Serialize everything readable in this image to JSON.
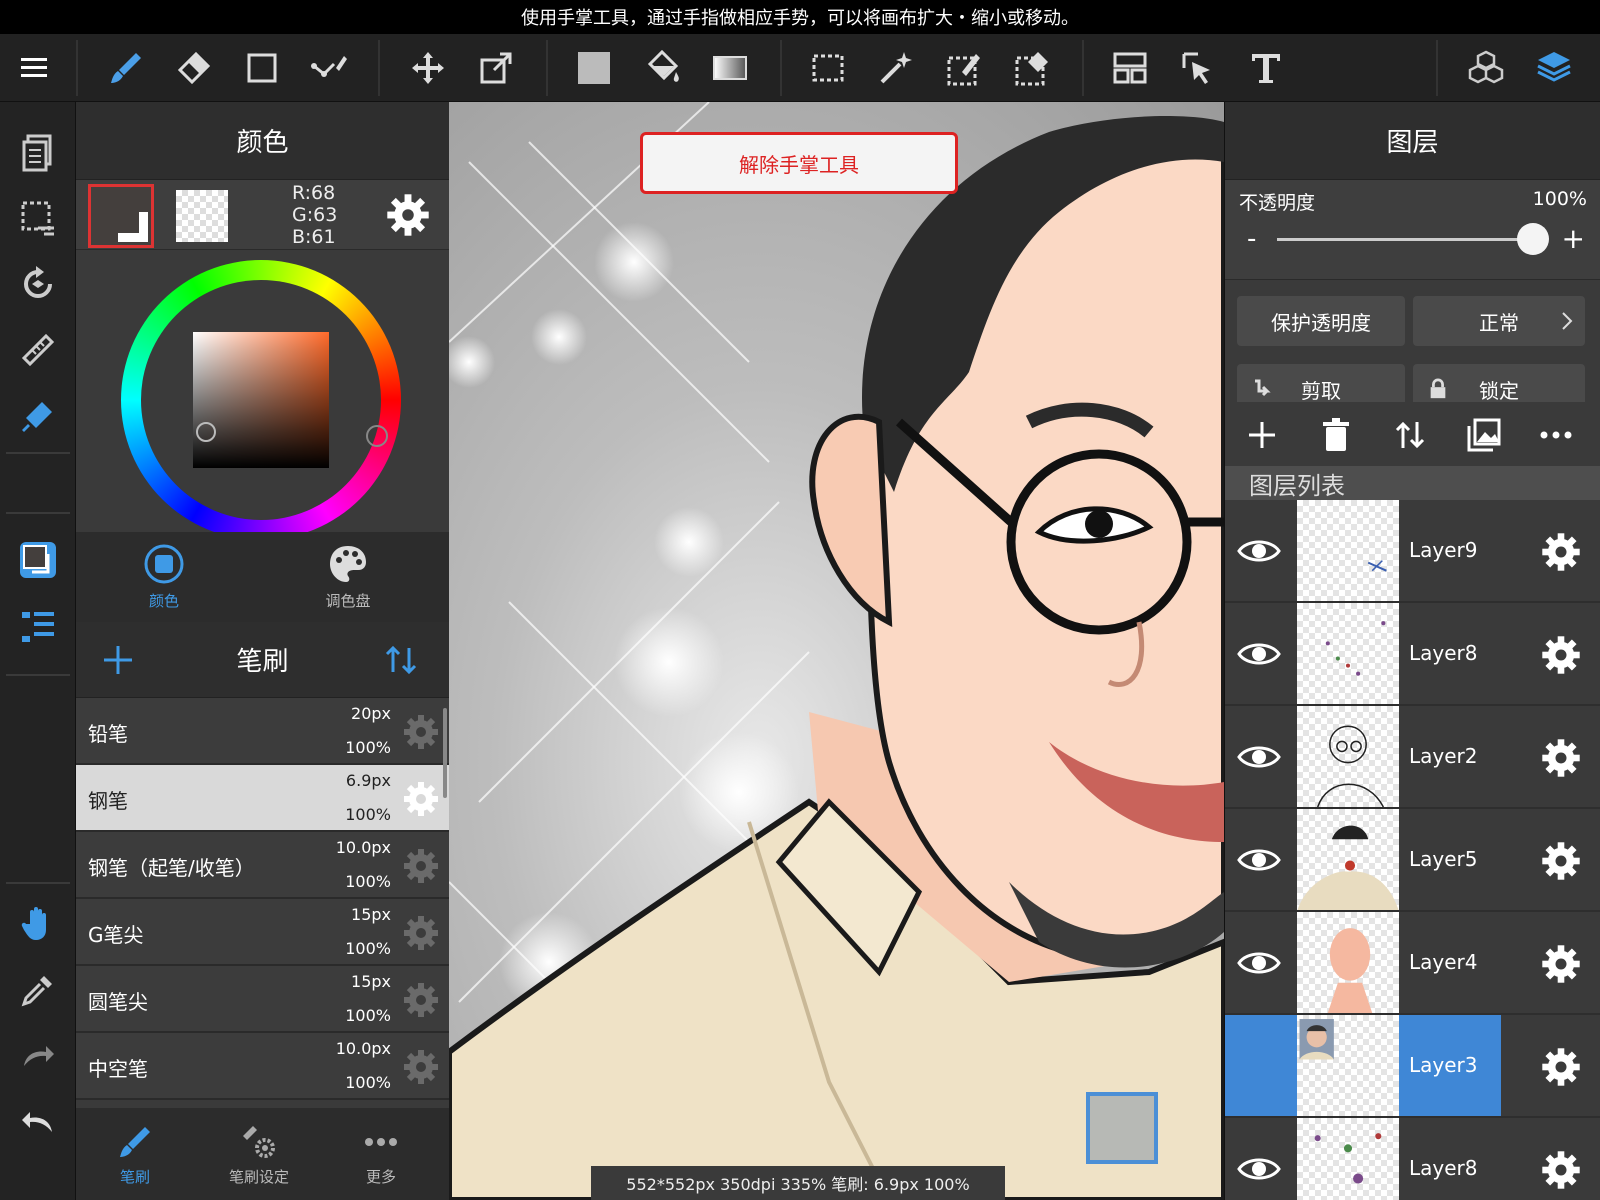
{
  "hint": "使用手掌工具，通过手指做相应手势，可以将画布扩大・缩小或移动。",
  "color_panel": {
    "title": "颜色",
    "r": "R:68",
    "g": "G:63",
    "b": "B:61",
    "main_color": "#443f3d",
    "tabs": [
      "颜色",
      "调色盘"
    ]
  },
  "brush_panel": {
    "title": "笔刷",
    "brushes": [
      {
        "name": "铅笔",
        "size": "20px",
        "opacity": "100%"
      },
      {
        "name": "钢笔",
        "size": "6.9px",
        "opacity": "100%",
        "selected": true
      },
      {
        "name": "钢笔（起笔/收笔）",
        "size": "10.0px",
        "opacity": "100%"
      },
      {
        "name": "G笔尖",
        "size": "15px",
        "opacity": "100%"
      },
      {
        "name": "圆笔尖",
        "size": "15px",
        "opacity": "100%"
      },
      {
        "name": "中空笔",
        "size": "10.0px",
        "opacity": "100%"
      }
    ],
    "tabs": [
      "笔刷",
      "笔刷设定",
      "更多"
    ]
  },
  "canvas": {
    "release_button": "解除手掌工具",
    "status": "552*552px 350dpi 335% 笔刷: 6.9px 100%"
  },
  "layers_panel": {
    "title": "图层",
    "opacity_label": "不透明度",
    "opacity_value": "100%",
    "opacity_fraction": 1.0,
    "minus": "-",
    "plus": "+",
    "protect_alpha": "保护透明度",
    "blend_mode": "正常",
    "clip": "剪取",
    "lock": "锁定",
    "list_header": "图层列表",
    "layers": [
      {
        "name": "Layer9",
        "selected": false
      },
      {
        "name": "Layer8",
        "selected": false
      },
      {
        "name": "Layer2",
        "selected": false
      },
      {
        "name": "Layer5",
        "selected": false
      },
      {
        "name": "Layer4",
        "selected": false
      },
      {
        "name": "Layer3",
        "selected": true
      },
      {
        "name": "Layer8",
        "selected": false
      }
    ]
  },
  "colors": {
    "accent": "#3f87d6",
    "warning": "#dd2222"
  }
}
